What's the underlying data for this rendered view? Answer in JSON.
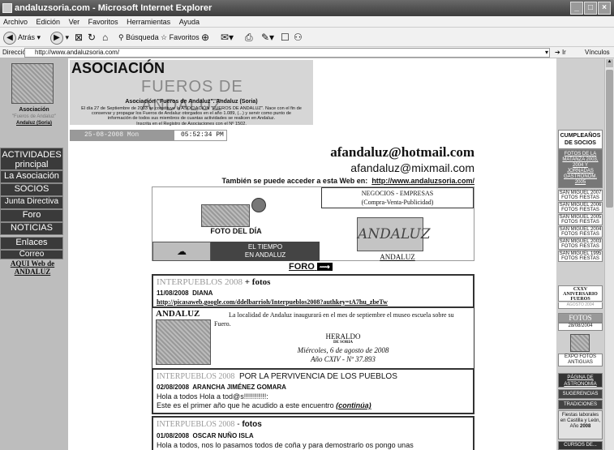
{
  "window": {
    "title": "andaluzsoria.com - Microsoft Internet Explorer"
  },
  "menu": [
    "Archivo",
    "Edición",
    "Ver",
    "Favoritos",
    "Herramientas",
    "Ayuda"
  ],
  "toolbar": {
    "back": "Atrás",
    "search": "Búsqueda",
    "favorites": "Favoritos"
  },
  "address": {
    "label": "Dirección",
    "url": "http://www.andaluzsoria.com/",
    "go": "Ir",
    "links": "Vínculos"
  },
  "header": {
    "title": "ASOCIACIÓN",
    "subtitle": "FUEROS DE ANDALUZ",
    "assoc_name": "Asociación \"Fueros de Andaluz\". Andaluz (Soria)",
    "desc1": "El día 27 de Septiembre de 2003 se constituye la ASOCIACIÓN \"FUEROS DE ANDALUZ\". Nace con el fin de",
    "desc2": "conservar y propagar los Fueros de Andaluz otorgados en el año 1.089, (...) y servir como punto de",
    "desc3": "información de todos sus miembros de cuantas actividades se realicen en Andaluz.",
    "desc4": "Inscrita en el Registro de Asociaciones con el Nº 1502.",
    "date": "25-08-2008 Mon",
    "time": "05:52:34 PM"
  },
  "left": {
    "logo_label": "Asociación",
    "logo_sub": "\"Fueros de Andaluz\"",
    "logo_sub2": "Andaluz (Soria)",
    "nav": [
      "ACTIVIDADES principal",
      "La Asociación",
      "SOCIOS",
      "Junta Directiva",
      "Foro",
      "NOTICIAS",
      "Enlaces",
      "Correo"
    ],
    "aqui": "AQUI Web de ANDALUZ"
  },
  "main": {
    "email1": "afandaluz@hotmail.com",
    "email2": "afandaluz@mixmail.com",
    "also": "También se puede acceder a esta Web en:",
    "url2": "http://www.andaluzsoria.com/",
    "negocios": "NEGOCIOS - EMPRESAS",
    "negocios_sub": "(Compra-Venta-Publicidad)",
    "foto_dia": "FOTO DEL DÍA",
    "tiempo1": "EL TIEMPO",
    "tiempo2": "EN ANDALUZ",
    "andaluz_logo": "ANDALUZ",
    "andaluz_link": "ANDALUZ",
    "foro": "FORO"
  },
  "posts": [
    {
      "title": "INTERPUEBLOS 2008",
      "plus": "+ fotos",
      "date": "11/08/2008",
      "author": "DIANA",
      "link": "http://picasaweb.google.com/ddelbarrioh/Interpueblos2008?authkey=tA7hu_zbeTw"
    },
    {
      "title": "ANDALUZ",
      "text": "La localidad de Andaluz inaugurará en el mes de septiembre el museo escuela sobre su Fuero.",
      "paper": "HERALDO",
      "paper_sub": "DE SORIA",
      "pdate": "Miércoles, 6 de agosto de 2008",
      "pyear": "Año CXIV - Nº 37.893"
    },
    {
      "title": "INTERPUEBLOS 2008",
      "title2": "POR LA PERVIVENCIA DE LOS PUEBLOS",
      "date": "02/08/2008",
      "author": "ARANCHA JIMÉNEZ GOMARA",
      "line1": "Hola a todos Hola a tod@s!!!!!!!!!!!:",
      "line2": "Este es el primer año que he acudido a este encuentro",
      "more": "(continúa)"
    },
    {
      "title": "INTERPUEBLOS 2008",
      "dash": "-",
      "fotos": "fotos",
      "date": "01/08/2008",
      "author": "OSCAR NUÑO ISLA",
      "line1": "Hola a todos, nos lo pasamos todos de coña y para demostrarlo os pongo unas"
    }
  ],
  "right": {
    "cumple": "CUMPLEAÑOS DE SOCIOS",
    "fotos_link": "FOTOS DE LA MATANZA 2003, 2004 Y JORNADAS GASTRONOM. 2005",
    "items": [
      "SAN MIGUEL 2007 FOTOS FIESTAS",
      "SAN MIGUEL 2006 FOTOS FIESTAS",
      "SAN MIGUEL 2005 FOTOS FIESTAS",
      "SAN MIGUEL 2004 FOTOS FIESTAS",
      "SAN MIGUEL 2003 FOTOS FIESTAS",
      "SAN MIGUEL 1995 FOTOS FIESTAS"
    ],
    "cxxv": "CXXV ANIVERSARIO FUEROS",
    "cxxv_sub": "AGOSTO 2004",
    "fotos": "FOTOS",
    "fotos_date": "28/08/2004",
    "expo": "EXPO FOTOS ANTIGUAS",
    "astro": "PÁGINA DE ASTRONOMÍA",
    "sugerencias": "SUGERENCIAS",
    "tradiciones": "TRADICIONES",
    "fiestas": "Fiestas laborales en Castilla y León, Año",
    "fiestas_year": "2008",
    "cursos": "CURSOS DE..."
  }
}
